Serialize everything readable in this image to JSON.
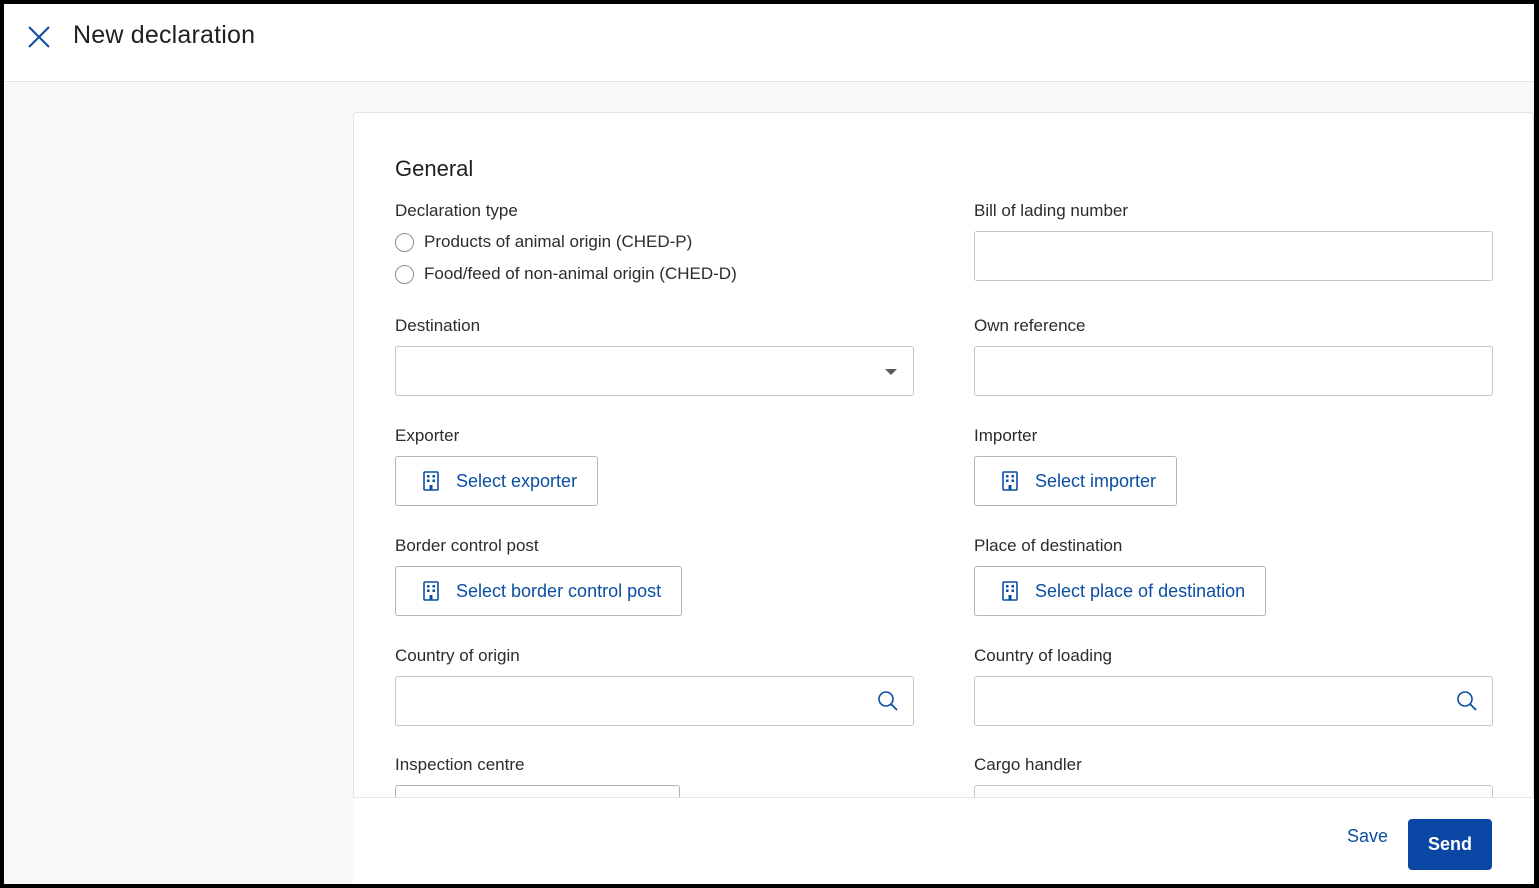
{
  "header": {
    "title": "New declaration",
    "close_icon": "close-icon"
  },
  "general": {
    "section_title": "General",
    "declaration_type": {
      "label": "Declaration type",
      "options": [
        "Products of animal origin (CHED-P)",
        "Food/feed of non-animal origin (CHED-D)"
      ]
    },
    "bill_of_lading": {
      "label": "Bill of lading number",
      "value": ""
    },
    "destination": {
      "label": "Destination",
      "value": ""
    },
    "own_reference": {
      "label": "Own reference",
      "value": ""
    },
    "exporter": {
      "label": "Exporter",
      "button": "Select exporter"
    },
    "importer": {
      "label": "Importer",
      "button": "Select importer"
    },
    "border_control_post": {
      "label": "Border control post",
      "button": "Select border control post"
    },
    "place_of_destination": {
      "label": "Place of destination",
      "button": "Select place of destination"
    },
    "country_of_origin": {
      "label": "Country of origin",
      "value": ""
    },
    "country_of_loading": {
      "label": "Country of loading",
      "value": ""
    },
    "inspection_centre": {
      "label": "Inspection centre"
    },
    "cargo_handler": {
      "label": "Cargo handler"
    }
  },
  "footer": {
    "save_label": "Save",
    "send_label": "Send"
  },
  "colors": {
    "accent": "#0a47a4",
    "link": "#0b4ea2"
  }
}
